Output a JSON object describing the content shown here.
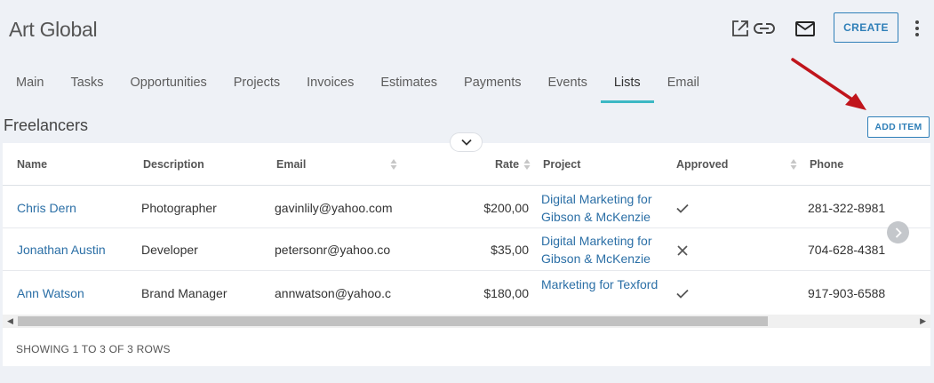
{
  "header": {
    "title": "Art Global",
    "create_label": "CREATE",
    "icons": [
      "open-external-icon",
      "link-icon",
      "mail-icon",
      "more-vertical-icon"
    ]
  },
  "tabs": [
    {
      "label": "Main",
      "active": false
    },
    {
      "label": "Tasks",
      "active": false
    },
    {
      "label": "Opportunities",
      "active": false
    },
    {
      "label": "Projects",
      "active": false
    },
    {
      "label": "Invoices",
      "active": false
    },
    {
      "label": "Estimates",
      "active": false
    },
    {
      "label": "Payments",
      "active": false
    },
    {
      "label": "Events",
      "active": false
    },
    {
      "label": "Lists",
      "active": true
    },
    {
      "label": "Email",
      "active": false
    }
  ],
  "section": {
    "title": "Freelancers",
    "add_item_label": "ADD ITEM"
  },
  "table": {
    "columns": [
      "Name",
      "Description",
      "Email",
      "Rate",
      "Project",
      "Approved",
      "Phone"
    ],
    "rows": [
      {
        "name": "Chris Dern",
        "description": "Photographer",
        "email": "gavinlily@yahoo.com",
        "rate": "$200,00",
        "project": "Digital Marketing for Gibson & McKenzie",
        "approved": true,
        "phone": "281-322-8981"
      },
      {
        "name": "Jonathan Austin",
        "description": "Developer",
        "email": "petersonr@yahoo.co",
        "rate": "$35,00",
        "project": "Digital Marketing for Gibson & McKenzie",
        "approved": false,
        "phone": "704-628-4381"
      },
      {
        "name": "Ann Watson",
        "description": "Brand Manager",
        "email": "annwatson@yahoo.c",
        "rate": "$180,00",
        "project": "Marketing for Texford",
        "approved": true,
        "phone": "917-903-6588"
      }
    ],
    "footer": "SHOWING 1 TO 3 OF 3 ROWS"
  },
  "colors": {
    "accent": "#2f7fb8",
    "tab_underline": "#3cb8c4",
    "annotation_arrow": "#c0151c",
    "background": "#eef1f6"
  }
}
